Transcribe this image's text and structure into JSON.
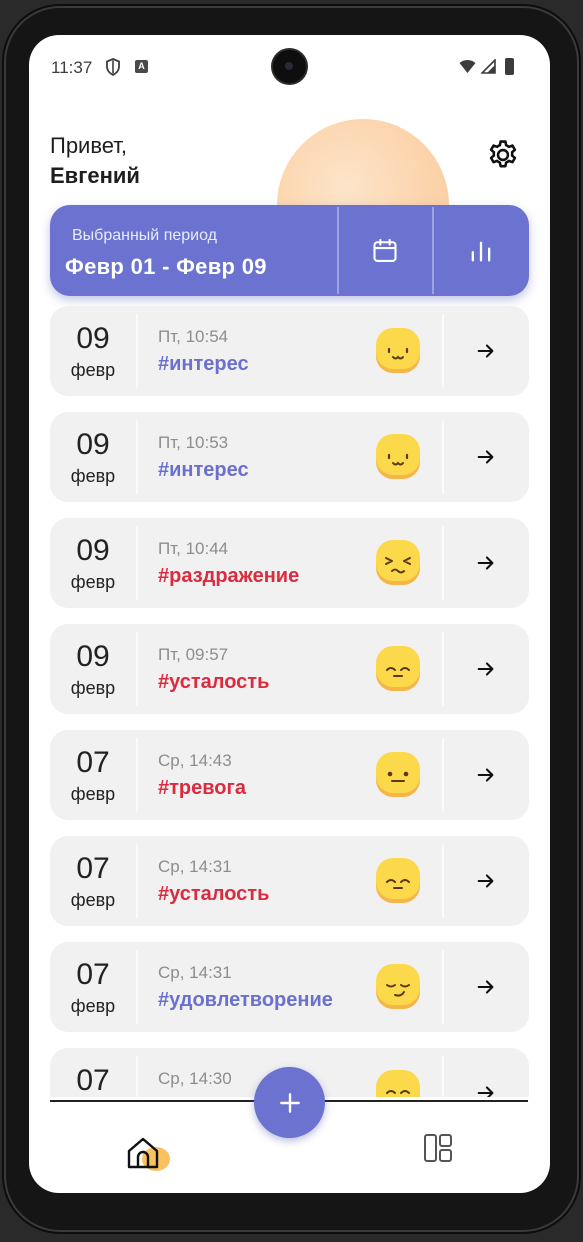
{
  "status_bar": {
    "time": "11:37"
  },
  "header": {
    "greeting": "Привет,",
    "name": "Евгений"
  },
  "period": {
    "label": "Выбранный период",
    "range": "Февр 01 - Февр 09"
  },
  "entries": [
    {
      "day": "09",
      "month": "февр",
      "time": "Пт, 10:54",
      "tag": "#интерес",
      "tone": "pos",
      "emoji": "smile"
    },
    {
      "day": "09",
      "month": "февр",
      "time": "Пт, 10:53",
      "tag": "#интерес",
      "tone": "pos",
      "emoji": "smile"
    },
    {
      "day": "09",
      "month": "февр",
      "time": "Пт, 10:44",
      "tag": "#раздражение",
      "tone": "neg",
      "emoji": "squint"
    },
    {
      "day": "09",
      "month": "февр",
      "time": "Пт, 09:57",
      "tag": "#усталость",
      "tone": "neg",
      "emoji": "tired"
    },
    {
      "day": "07",
      "month": "февр",
      "time": "Ср, 14:43",
      "tag": "#тревога",
      "tone": "neg",
      "emoji": "neutral"
    },
    {
      "day": "07",
      "month": "февр",
      "time": "Ср, 14:31",
      "tag": "#усталость",
      "tone": "neg",
      "emoji": "tired"
    },
    {
      "day": "07",
      "month": "февр",
      "time": "Ср, 14:31",
      "tag": "#удовлетворение",
      "tone": "pos",
      "emoji": "smirk"
    },
    {
      "day": "07",
      "month": "",
      "time": "Ср, 14:30",
      "tag": "",
      "tone": "pos",
      "emoji": "happy"
    }
  ],
  "colors": {
    "accent": "#6b72cf",
    "positive_tag": "#6b70cf",
    "negative_tag": "#dc2b3f",
    "emoji_yellow": "#fbd94a"
  },
  "icons": {
    "settings": "gear-icon",
    "calendar": "calendar-icon",
    "stats": "bar-chart-icon",
    "add": "plus-icon",
    "home": "home-icon",
    "dashboard": "dashboard-icon"
  }
}
